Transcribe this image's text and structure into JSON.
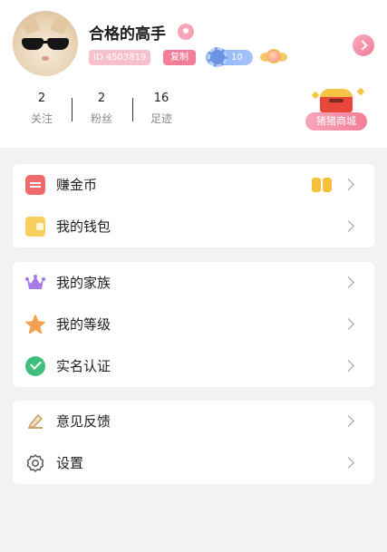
{
  "profile": {
    "username": "合格的高手",
    "id_label": "ID 4503819",
    "copy_label": "复制",
    "level": "10"
  },
  "stats": [
    {
      "value": "2",
      "label": "关注"
    },
    {
      "value": "2",
      "label": "粉丝"
    },
    {
      "value": "16",
      "label": "足迹"
    }
  ],
  "shop": {
    "label": "猪猪商城"
  },
  "menu": {
    "group1": [
      {
        "label": "赚金币",
        "icon": "coin-list-icon"
      },
      {
        "label": "我的钱包",
        "icon": "wallet-icon"
      }
    ],
    "group2": [
      {
        "label": "我的家族",
        "icon": "crown-icon"
      },
      {
        "label": "我的等级",
        "icon": "star-icon"
      },
      {
        "label": "实名认证",
        "icon": "verified-icon"
      }
    ],
    "group3": [
      {
        "label": "意见反馈",
        "icon": "feedback-icon"
      },
      {
        "label": "设置",
        "icon": "gear-icon"
      }
    ]
  },
  "colors": {
    "accent_pink": "#f37e99",
    "background": "#f2f2f3"
  }
}
